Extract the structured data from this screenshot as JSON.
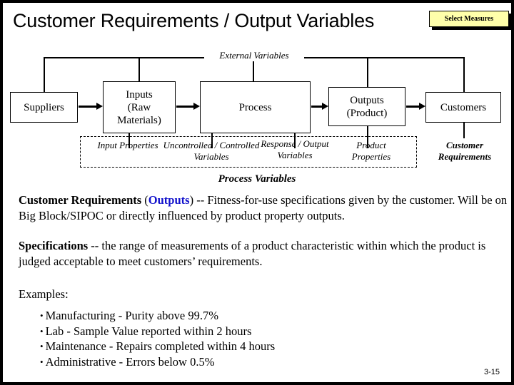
{
  "slide": {
    "title": "Customer Requirements / Output Variables",
    "page_number": "3-15",
    "border_color": "#000000"
  },
  "toolbar": {
    "select_measures_label": "Select Measures",
    "button_fill": "#ffffaa",
    "button_shadow": "#000000"
  },
  "diagram": {
    "external_variables_label": "External Variables",
    "process_variables_title": "Process Variables",
    "customer_requirements_label_line1": "Customer",
    "customer_requirements_label_line2": "Requirements",
    "boxes": [
      {
        "id": "suppliers",
        "label": "Suppliers"
      },
      {
        "id": "inputs",
        "label": "Inputs (Raw Materials)"
      },
      {
        "id": "process",
        "label": "Process"
      },
      {
        "id": "outputs",
        "label": "Outputs (Product)"
      },
      {
        "id": "customers",
        "label": "Customers"
      }
    ],
    "box_labels": {
      "suppliers": "Suppliers",
      "inputs_line1": "Inputs",
      "inputs_line2": "(Raw",
      "inputs_line3": "Materials)",
      "process": "Process",
      "outputs_line1": "Outputs",
      "outputs_line2": "(Product)",
      "customers": "Customers"
    },
    "process_variable_labels": [
      "Input Properties",
      "Uncontrolled / Controlled Variables",
      "Response / Output Variables",
      "Product Properties"
    ]
  },
  "body": {
    "para1": {
      "term": "Customer Requirements",
      "paren_open": " (",
      "highlight": "Outputs",
      "paren_close": ")",
      "rest": " -- Fitness-for-use specifications given by the customer. Will be on Big Block/SIPOC or directly influenced by product property outputs.",
      "highlight_color": "#1111cc"
    },
    "para2": {
      "term": "Specifications",
      "rest": " -- the range of measurements of a product characteristic within which the product is judged acceptable to meet customers’ requirements."
    },
    "examples_heading": "Examples:",
    "bullets": [
      "Manufacturing - Purity above 99.7%",
      "Lab - Sample Value reported within 2 hours",
      "Maintenance - Repairs completed within 4 hours",
      "Administrative - Errors below 0.5%"
    ]
  }
}
